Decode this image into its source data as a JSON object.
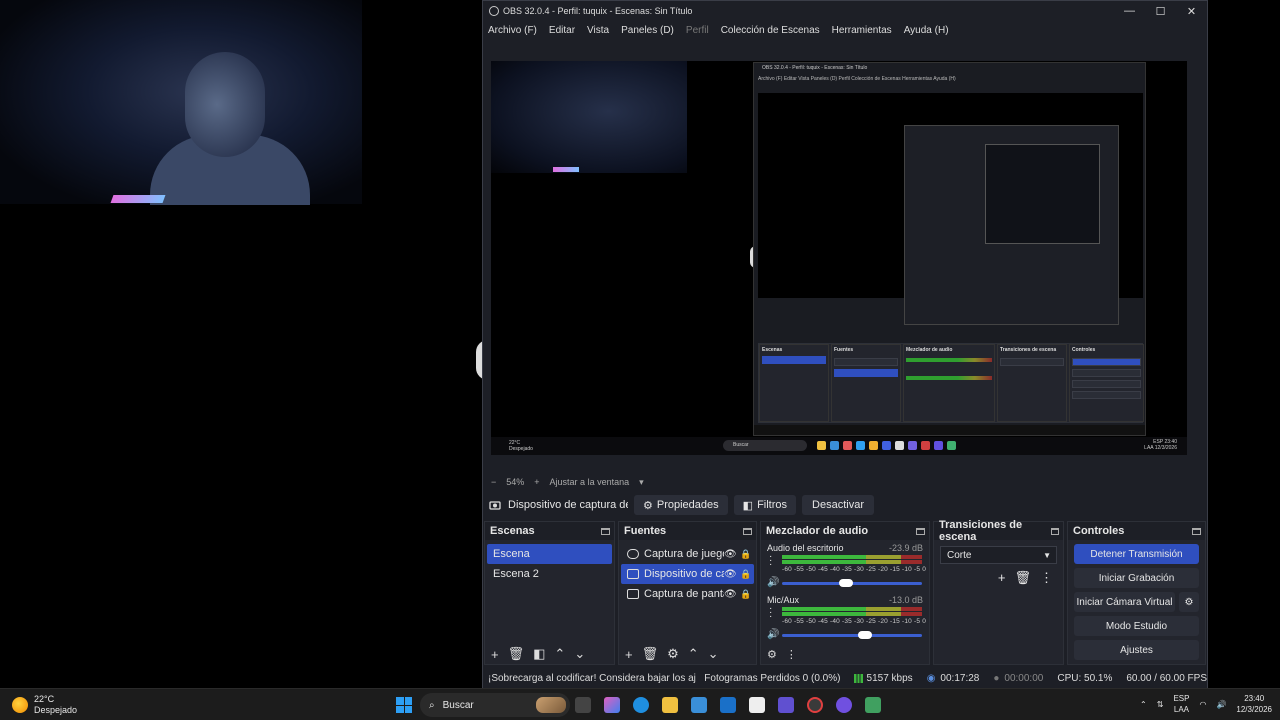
{
  "window": {
    "title": "OBS 32.0.4 - Perfil: tuquix - Escenas: Sin Título"
  },
  "menu": [
    "Archivo (F)",
    "Editar",
    "Vista",
    "Paneles (D)",
    "Perfil",
    "Colección de Escenas",
    "Herramientas",
    "Ayuda (H)"
  ],
  "preview": {
    "inner_title": "OBS 32.0.4 - Perfil: tuquix - Escenas: Sin Título",
    "inner_menu": "Archivo (F)   Editar   Vista   Paneles (D)   Perfil   Colección de Escenas   Herramientas   Ayuda (H)",
    "inner_taskbar": {
      "temp": "22°C",
      "weather": "Despejado",
      "search": "Buscar",
      "lang": "ESP",
      "lang2": "LAA",
      "time": "23:40",
      "date": "12/3/2026"
    }
  },
  "zoom": {
    "minus": "−",
    "level": "54%",
    "plus": "+",
    "fit": "Ajustar a la ventana",
    "arrow": "▾"
  },
  "source_bar": {
    "name": "Dispositivo de captura de v",
    "props": "Propiedades",
    "filters": "Filtros",
    "deactivate": "Desactivar"
  },
  "scenes": {
    "title": "Escenas",
    "items": [
      "Escena",
      "Escena 2"
    ]
  },
  "sources": {
    "title": "Fuentes",
    "items": [
      "Captura de juego",
      "Dispositivo de captura de video",
      "Captura de pantalla"
    ]
  },
  "mixer": {
    "title": "Mezclador de audio",
    "scale": "-60 -55 -50 -45 -40 -35 -30 -25 -20 -15 -10 -5  0",
    "channels": [
      {
        "name": "Audio del escritorio",
        "db": "-23.9 dB",
        "volume": 0.45
      },
      {
        "name": "Mic/Aux",
        "db": "-13.0 dB",
        "volume": 0.6
      }
    ]
  },
  "transitions": {
    "title": "Transiciones de escena",
    "current": "Corte"
  },
  "controls": {
    "title": "Controles",
    "buttons": [
      "Detener Transmisión",
      "Iniciar Grabación",
      "Iniciar Cámara Virtual",
      "Modo Estudio",
      "Ajustes"
    ]
  },
  "status": {
    "warning": "¡Sobrecarga al codificar! Considera bajar los ajustes de vídeo o us",
    "dropped": "Fotogramas Perdidos 0 (0.0%)",
    "bitrate": "5157 kbps",
    "stream_time": "00:17:28",
    "rec_time": "00:00:00",
    "cpu": "CPU: 50.1%",
    "fps": "60.00 / 60.00 FPS"
  },
  "taskbar": {
    "temp": "22°C",
    "weather": "Despejado",
    "search": "Buscar",
    "lang": "ESP",
    "lang2": "LAA",
    "time": "23:40",
    "date": "12/3/2026"
  }
}
